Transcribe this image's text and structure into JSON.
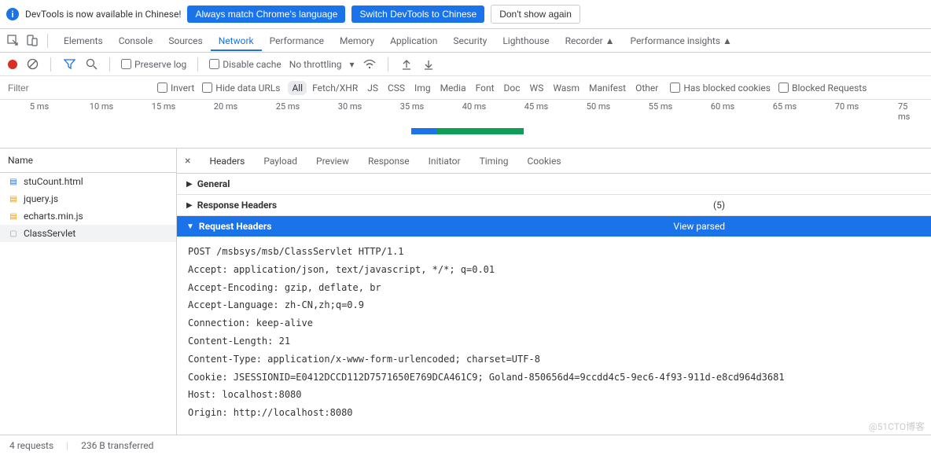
{
  "infobar": {
    "text": "DevTools is now available in Chinese!",
    "btn1": "Always match Chrome's language",
    "btn2": "Switch DevTools to Chinese",
    "btn3": "Don't show again"
  },
  "tabs": [
    "Elements",
    "Console",
    "Sources",
    "Network",
    "Performance",
    "Memory",
    "Application",
    "Security",
    "Lighthouse",
    "Recorder ▲",
    "Performance insights ▲"
  ],
  "active_tab": "Network",
  "toolbar": {
    "preserve": "Preserve log",
    "disable": "Disable cache",
    "throttle": "No throttling"
  },
  "filterbar": {
    "placeholder": "Filter",
    "invert": "Invert",
    "hide": "Hide data URLs",
    "types": [
      "All",
      "Fetch/XHR",
      "JS",
      "CSS",
      "Img",
      "Media",
      "Font",
      "Doc",
      "WS",
      "Wasm",
      "Manifest",
      "Other"
    ],
    "hbc": "Has blocked cookies",
    "br": "Blocked Requests"
  },
  "timeline": {
    "ticks": [
      "5 ms",
      "10 ms",
      "15 ms",
      "20 ms",
      "25 ms",
      "30 ms",
      "35 ms",
      "40 ms",
      "45 ms",
      "50 ms",
      "55 ms",
      "60 ms",
      "65 ms",
      "70 ms",
      "75 ms"
    ]
  },
  "left": {
    "head": "Name",
    "files": [
      {
        "name": "stuCount.html",
        "color": "#1a73e8",
        "icon": "▤"
      },
      {
        "name": "jquery.js",
        "color": "#f29900",
        "icon": "▤"
      },
      {
        "name": "echarts.min.js",
        "color": "#f29900",
        "icon": "▤"
      },
      {
        "name": "ClassServlet",
        "color": "#9aa0a6",
        "icon": "▢"
      }
    ],
    "selected": 3
  },
  "right": {
    "tabs": [
      "Headers",
      "Payload",
      "Preview",
      "Response",
      "Initiator",
      "Timing",
      "Cookies"
    ],
    "active": "Headers",
    "sections": {
      "general": "General",
      "resp": "Response Headers",
      "resp_count": "(5)",
      "req": "Request Headers",
      "view": "View parsed"
    },
    "headers": [
      "POST /msbsys/msb/ClassServlet HTTP/1.1",
      "Accept: application/json, text/javascript, */*; q=0.01",
      "Accept-Encoding: gzip, deflate, br",
      "Accept-Language: zh-CN,zh;q=0.9",
      "Connection: keep-alive",
      "Content-Length: 21",
      "Content-Type: application/x-www-form-urlencoded; charset=UTF-8",
      "Cookie: JSESSIONID=E0412DCCD112D7571650E769DCA461C9; Goland-850656d4=9ccdd4c5-9ec6-4f93-911d-e8cd964d3681",
      "Host: localhost:8080",
      "Origin: http://localhost:8080"
    ]
  },
  "status": {
    "req": "4 requests",
    "xfer": "236 B transferred"
  },
  "watermark": "@51CTO博客"
}
